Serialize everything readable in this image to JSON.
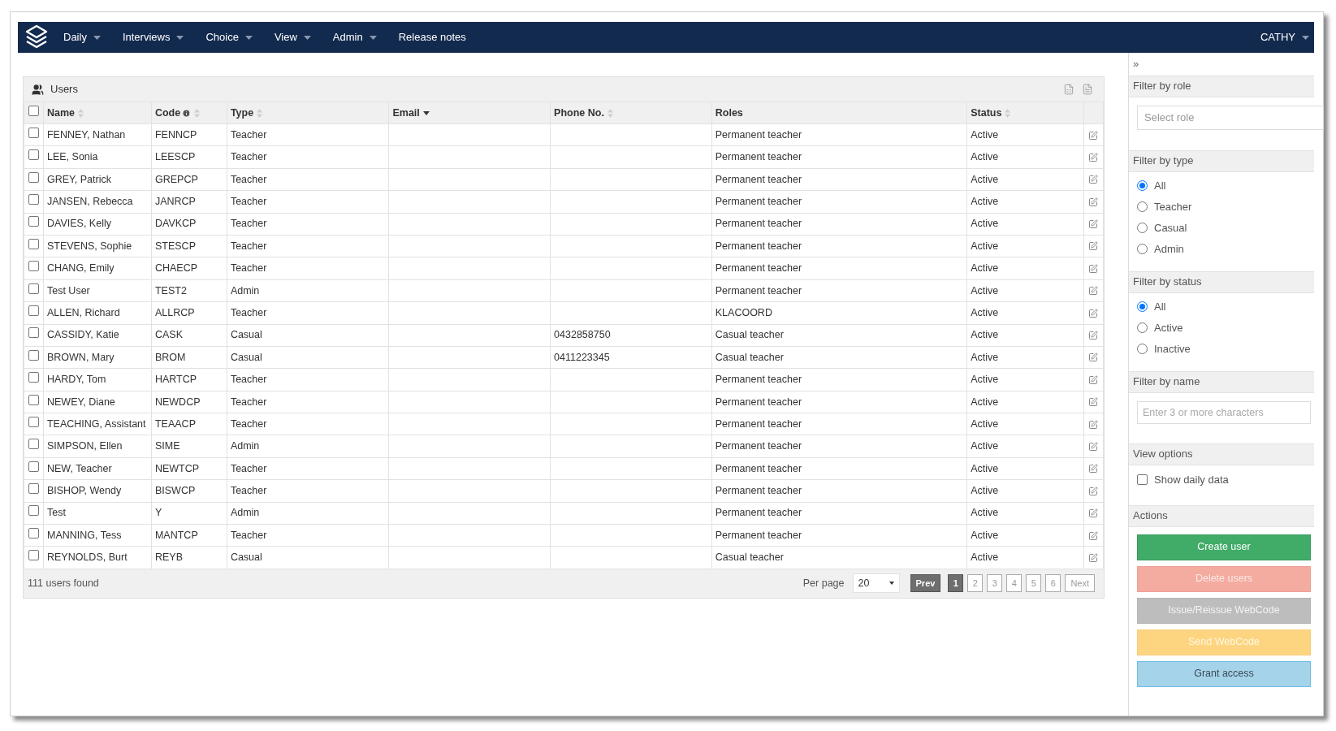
{
  "nav": {
    "items": [
      {
        "label": "Daily",
        "dropdown": true
      },
      {
        "label": "Interviews",
        "dropdown": true
      },
      {
        "label": "Choice",
        "dropdown": true
      },
      {
        "label": "View",
        "dropdown": true
      },
      {
        "label": "Admin",
        "dropdown": true
      },
      {
        "label": "Release notes",
        "dropdown": false
      }
    ],
    "user": {
      "label": "CATHY",
      "dropdown": true
    }
  },
  "panel": {
    "title": "Users"
  },
  "table": {
    "select_all": {
      "checked": false
    },
    "columns": [
      {
        "label": "Name",
        "sortable": true,
        "sorted": false,
        "info": false
      },
      {
        "label": "Code",
        "sortable": true,
        "sorted": false,
        "info": true
      },
      {
        "label": "Type",
        "sortable": true,
        "sorted": false,
        "info": false
      },
      {
        "label": "Email",
        "sortable": true,
        "sorted": true,
        "info": false
      },
      {
        "label": "Phone No.",
        "sortable": true,
        "sorted": false,
        "info": false
      },
      {
        "label": "Roles",
        "sortable": false,
        "info": false
      },
      {
        "label": "Status",
        "sortable": true,
        "sorted": false,
        "info": false
      }
    ],
    "rows": [
      {
        "checked": false,
        "cells": [
          "FENNEY, Nathan",
          "FENNCP",
          "Teacher",
          "",
          "",
          "Permanent teacher",
          "Active"
        ]
      },
      {
        "checked": false,
        "cells": [
          "LEE, Sonia",
          "LEESCP",
          "Teacher",
          "",
          "",
          "Permanent teacher",
          "Active"
        ]
      },
      {
        "checked": false,
        "cells": [
          "GREY, Patrick",
          "GREPCP",
          "Teacher",
          "",
          "",
          "Permanent teacher",
          "Active"
        ]
      },
      {
        "checked": false,
        "cells": [
          "JANSEN, Rebecca",
          "JANRCP",
          "Teacher",
          "",
          "",
          "Permanent teacher",
          "Active"
        ]
      },
      {
        "checked": false,
        "cells": [
          "DAVIES, Kelly",
          "DAVKCP",
          "Teacher",
          "",
          "",
          "Permanent teacher",
          "Active"
        ]
      },
      {
        "checked": false,
        "cells": [
          "STEVENS, Sophie",
          "STESCP",
          "Teacher",
          "",
          "",
          "Permanent teacher",
          "Active"
        ]
      },
      {
        "checked": false,
        "cells": [
          "CHANG, Emily",
          "CHAECP",
          "Teacher",
          "",
          "",
          "Permanent teacher",
          "Active"
        ]
      },
      {
        "checked": false,
        "cells": [
          "Test User",
          "TEST2",
          "Admin",
          "",
          "",
          "Permanent teacher",
          "Active"
        ]
      },
      {
        "checked": false,
        "cells": [
          "ALLEN, Richard",
          "ALLRCP",
          "Teacher",
          "",
          "",
          "KLACOORD",
          "Active"
        ]
      },
      {
        "checked": false,
        "cells": [
          "CASSIDY, Katie",
          "CASK",
          "Casual",
          "",
          "0432858750",
          "Casual teacher",
          "Active"
        ]
      },
      {
        "checked": false,
        "cells": [
          "BROWN, Mary",
          "BROM",
          "Casual",
          "",
          "0411223345",
          "Casual teacher",
          "Active"
        ]
      },
      {
        "checked": false,
        "cells": [
          "HARDY, Tom",
          "HARTCP",
          "Teacher",
          "",
          "",
          "Permanent teacher",
          "Active"
        ]
      },
      {
        "checked": false,
        "cells": [
          "NEWEY, Diane",
          "NEWDCP",
          "Teacher",
          "",
          "",
          "Permanent teacher",
          "Active"
        ]
      },
      {
        "checked": false,
        "cells": [
          "TEACHING, Assistant",
          "TEAACP",
          "Teacher",
          "",
          "",
          "Permanent teacher",
          "Active"
        ]
      },
      {
        "checked": false,
        "cells": [
          "SIMPSON, Ellen",
          "SIME",
          "Admin",
          "",
          "",
          "Permanent teacher",
          "Active"
        ]
      },
      {
        "checked": false,
        "cells": [
          "NEW, Teacher",
          "NEWTCP",
          "Teacher",
          "",
          "",
          "Permanent teacher",
          "Active"
        ]
      },
      {
        "checked": false,
        "cells": [
          "BISHOP, Wendy",
          "BISWCP",
          "Teacher",
          "",
          "",
          "Permanent teacher",
          "Active"
        ]
      },
      {
        "checked": false,
        "cells": [
          "Test",
          "Y",
          "Admin",
          "",
          "",
          "Permanent teacher",
          "Active"
        ]
      },
      {
        "checked": false,
        "cells": [
          "MANNING, Tess",
          "MANTCP",
          "Teacher",
          "",
          "",
          "Permanent teacher",
          "Active"
        ]
      },
      {
        "checked": false,
        "cells": [
          "REYNOLDS, Burt",
          "REYB",
          "Casual",
          "",
          "",
          "Casual teacher",
          "Active"
        ]
      }
    ]
  },
  "footer": {
    "count": "111 users found",
    "per_page_label": "Per page",
    "per_page_value": "20",
    "prev": {
      "label": "Prev",
      "disabled": true
    },
    "pages": [
      {
        "label": "1",
        "selected": true
      },
      {
        "label": "2",
        "selected": false
      },
      {
        "label": "3",
        "selected": false
      },
      {
        "label": "4",
        "selected": false
      },
      {
        "label": "5",
        "selected": false
      },
      {
        "label": "6",
        "selected": false
      }
    ],
    "next": {
      "label": "Next",
      "disabled": false
    }
  },
  "sidebar": {
    "collapse": "»",
    "role": {
      "title": "Filter by role",
      "placeholder": "Select role"
    },
    "type": {
      "title": "Filter by type",
      "options": [
        {
          "label": "All",
          "selected": true
        },
        {
          "label": "Teacher",
          "selected": false
        },
        {
          "label": "Casual",
          "selected": false
        },
        {
          "label": "Admin",
          "selected": false
        }
      ]
    },
    "status": {
      "title": "Filter by status",
      "options": [
        {
          "label": "All",
          "selected": true
        },
        {
          "label": "Active",
          "selected": false
        },
        {
          "label": "Inactive",
          "selected": false
        }
      ]
    },
    "name": {
      "title": "Filter by name",
      "placeholder": "Enter 3 or more characters"
    },
    "view": {
      "title": "View options",
      "options": [
        {
          "label": "Show daily data",
          "checked": false
        }
      ]
    },
    "actions": {
      "title": "Actions",
      "buttons": [
        {
          "label": "Create user",
          "kind": "success",
          "disabled": false
        },
        {
          "label": "Delete users",
          "kind": "danger",
          "disabled": true
        },
        {
          "label": "Issue/Reissue WebCode",
          "kind": "default",
          "disabled": true
        },
        {
          "label": "Send WebCode",
          "kind": "warning",
          "disabled": true
        },
        {
          "label": "Grant access",
          "kind": "info",
          "disabled": false
        }
      ]
    }
  }
}
